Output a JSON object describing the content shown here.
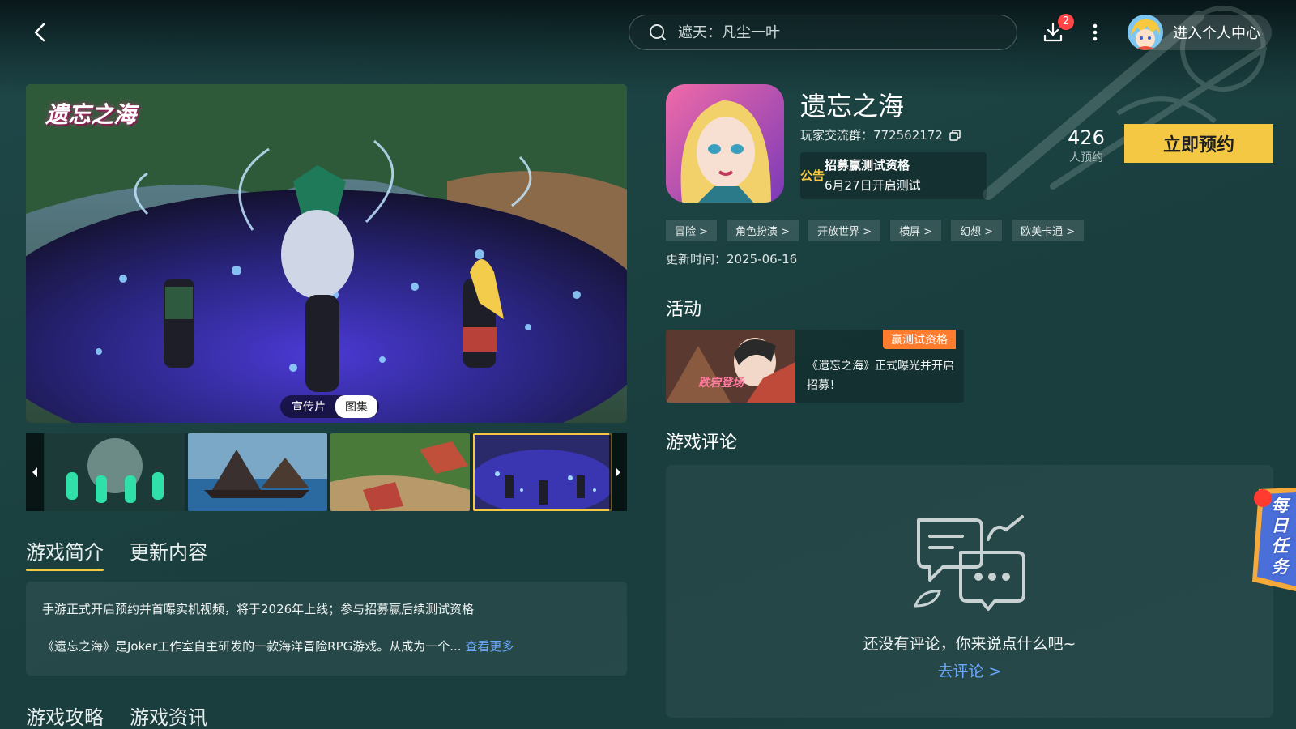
{
  "header": {
    "search_placeholder": "遮天：凡尘一叶",
    "download_badge": "2",
    "user_center_label": "进入个人中心"
  },
  "media": {
    "hero_logo": "遗忘之海",
    "tabs": [
      {
        "label": "宣传片",
        "active": false
      },
      {
        "label": "图集",
        "active": true
      }
    ],
    "selected_thumbnail": 4
  },
  "intro": {
    "tabs": [
      {
        "label": "游戏简介",
        "active": true
      },
      {
        "label": "更新内容",
        "active": false
      }
    ],
    "line1": "手游正式开启预约并首曝实机视频，将于2026年上线；参与招募赢后续测试资格",
    "line2": "《遗忘之海》是Joker工作室自主研发的一款海洋冒险RPG游戏。从成为一个...",
    "more_label": "查看更多"
  },
  "bottom_tabs": [
    {
      "label": "游戏攻略",
      "active": true
    },
    {
      "label": "游戏资讯",
      "active": false
    }
  ],
  "game": {
    "title": "遗忘之海",
    "group_label": "玩家交流群：772562172",
    "notice_tag": "公告",
    "notice_title": "招募赢测试资格",
    "notice_sub": "6月27日开启测试",
    "reserve_count": "426",
    "reserve_count_label": "人预约",
    "reserve_button": "立即预约",
    "tags": [
      "冒险 >",
      "角色扮演 >",
      "开放世界 >",
      "横屏 >",
      "幻想 >",
      "欧美卡通 >"
    ],
    "update_time": "更新时间：2025-06-16"
  },
  "activity": {
    "section_title": "活动",
    "badge": "赢测试资格",
    "text": "《遗忘之海》正式曝光并开启招募！"
  },
  "reviews": {
    "section_title": "游戏评论",
    "empty_text": "还没有评论，你来说点什么吧~",
    "link_label": "去评论 >"
  },
  "daily_task": {
    "label": "每日任务"
  },
  "colors": {
    "accent": "#f5c843",
    "link": "#6aa9ff",
    "badge_red": "#ff4545",
    "activity_badge": "#ff7b2e"
  }
}
